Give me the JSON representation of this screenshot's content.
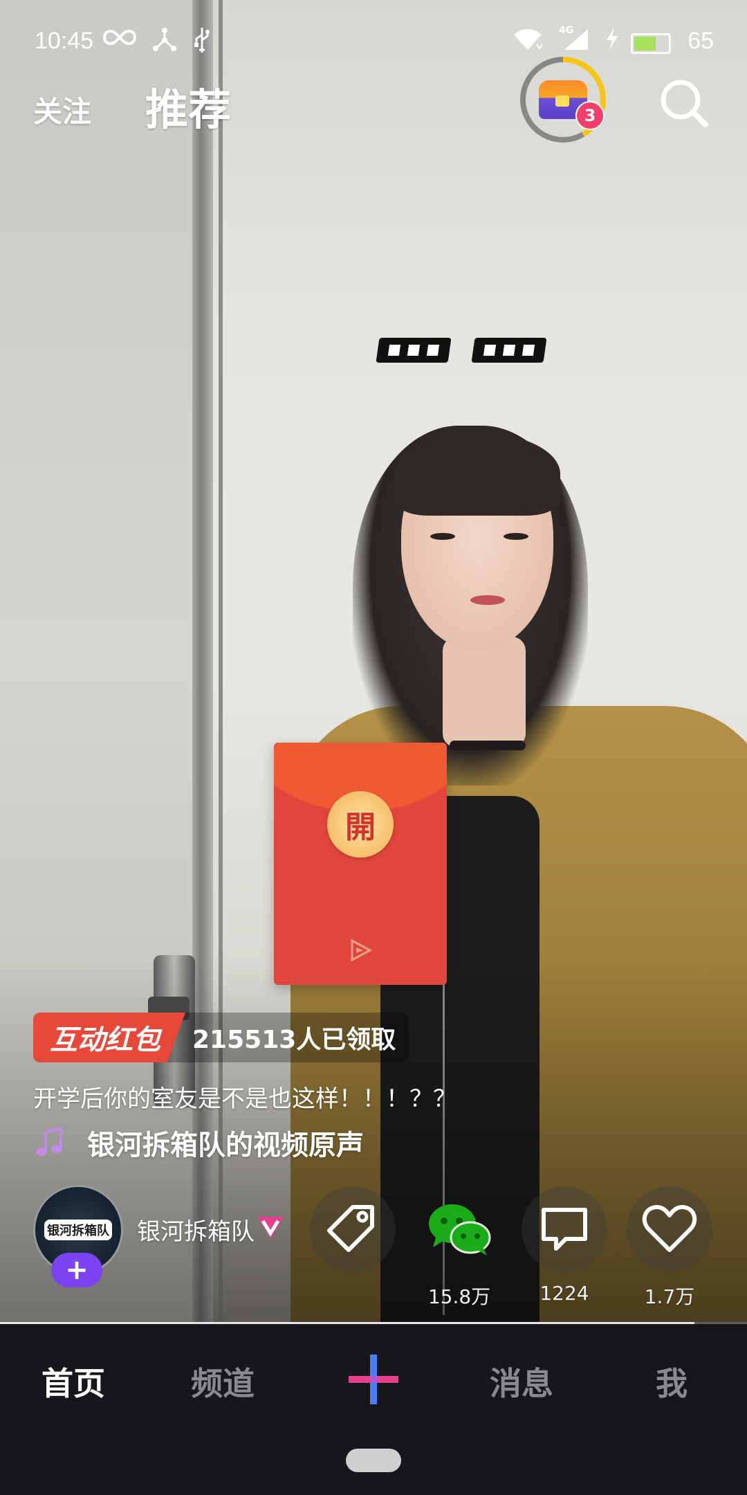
{
  "status_bar": {
    "time": "10:45",
    "battery_percent": "65",
    "network": "4G",
    "battery_level": 0.65
  },
  "top_tabs": {
    "follow": "关注",
    "recommend": "推荐"
  },
  "treasure": {
    "badge_count": "3"
  },
  "video": {
    "overlay_marks": "▪▪▪ ▪▪▪"
  },
  "red_envelope": {
    "open_char": "開"
  },
  "promo": {
    "tag": "互动红包",
    "count_text": "215513人已领取"
  },
  "caption": "开学后你的室友是不是也这样！！！？？",
  "music": {
    "label": "银河拆箱队的视频原声"
  },
  "author": {
    "name": "银河拆箱队",
    "avatar_text": "银河拆箱队",
    "follow_symbol": "+"
  },
  "actions": {
    "share_count": "15.8万",
    "comment_count": "1224",
    "like_count": "1.7万"
  },
  "progress": 0.93,
  "bottom_nav": {
    "home": "首页",
    "channel": "频道",
    "messages": "消息",
    "me": "我"
  },
  "colors": {
    "accent_red": "#e8483a",
    "follow_purple": "#7b43f2",
    "wechat_green": "#1aad19",
    "nav_bg": "#17161b"
  }
}
